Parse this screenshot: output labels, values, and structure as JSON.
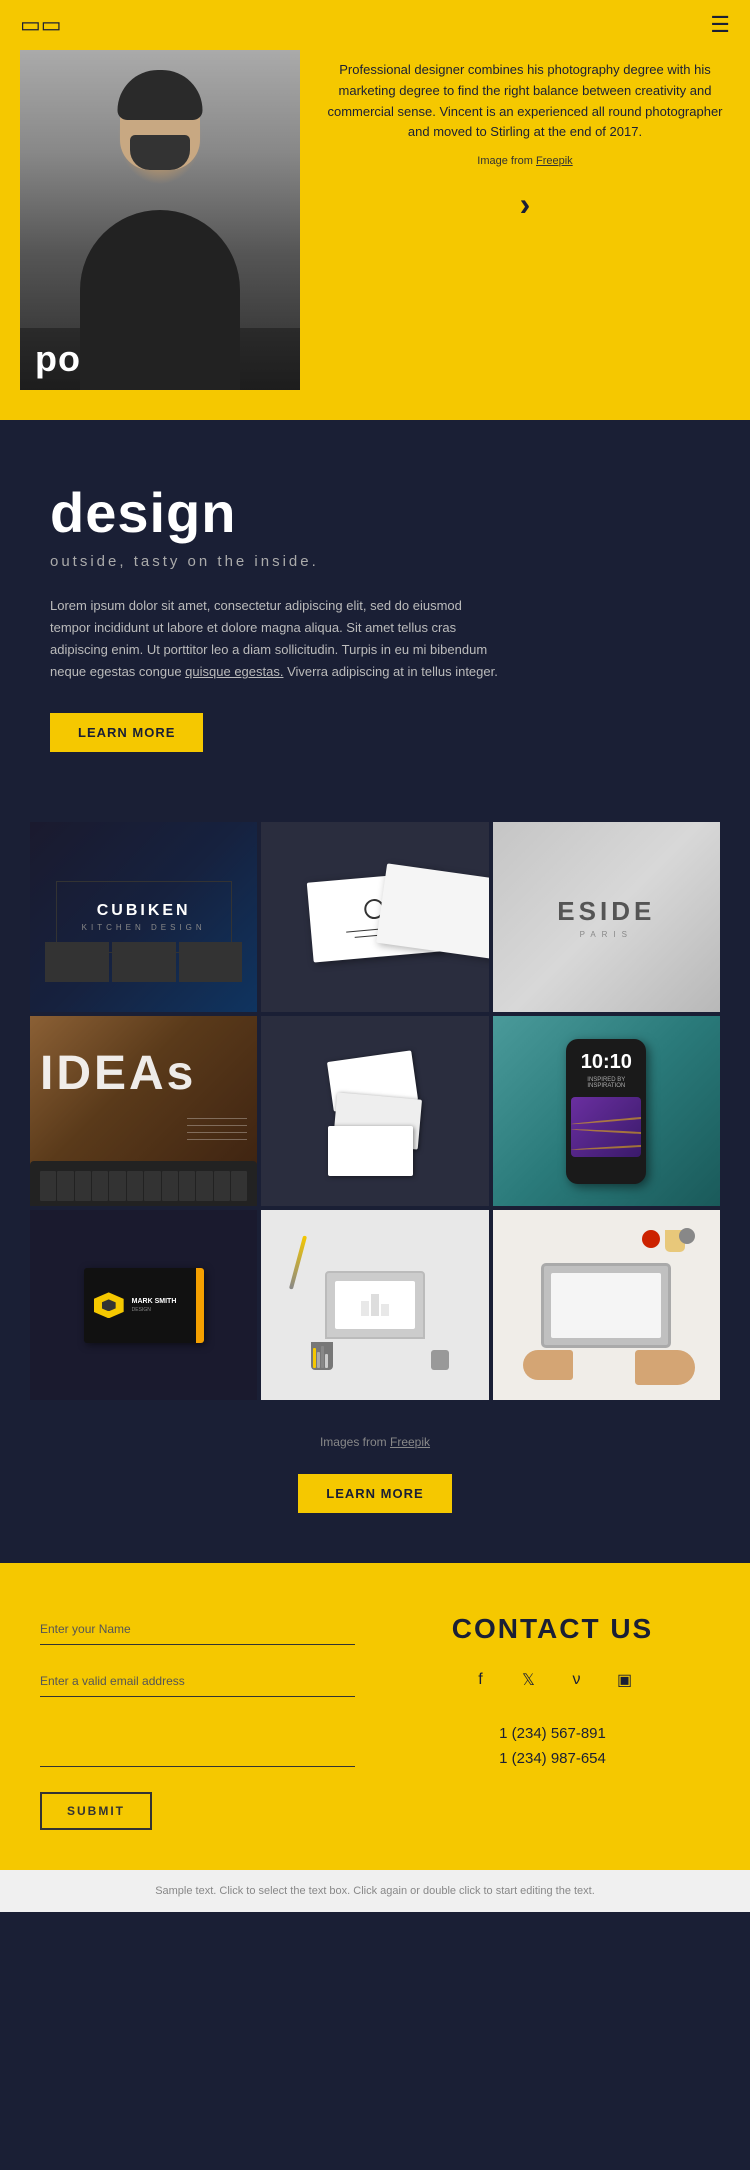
{
  "header": {
    "logo_icon": "book-open-icon",
    "menu_icon": "hamburger-icon"
  },
  "hero": {
    "title": "portfolio",
    "description": "Professional designer combines his photography degree with his marketing degree to find the right balance between creativity and commercial sense. Vincent is an experienced all round photographer and moved to Stirling at the end of 2017.",
    "image_credit_prefix": "Image from",
    "image_credit_link": "Freepik",
    "arrow_label": "›"
  },
  "design_section": {
    "heading": "design",
    "subtitle": "outside, tasty on the inside.",
    "body": "Lorem ipsum dolor sit amet, consectetur adipiscing elit, sed do eiusmod tempor incididunt ut labore et dolore magna aliqua. Sit amet tellus cras adipiscing enim. Ut porttitor leo a diam sollicitudin. Turpis in eu mi bibendum neque egestas congue quisque egestas. Viverra adipiscing at in tellus integer.",
    "learn_more_label": "LEARN MORE"
  },
  "portfolio_grid": {
    "items": [
      {
        "id": "cubiken",
        "brand": "CUBIKEN",
        "sub": "KITCHEN DESIGN"
      },
      {
        "id": "business-cards-1",
        "label": "Business Cards"
      },
      {
        "id": "eside",
        "brand": "ESIDE",
        "sub": "PARIS"
      },
      {
        "id": "ideas",
        "label": "IDEAs"
      },
      {
        "id": "business-cards-2",
        "label": "Business Cards Stack"
      },
      {
        "id": "phone",
        "time": "10:10",
        "sub": "INSPIRED BY INSPIRATION"
      },
      {
        "id": "design-card",
        "label": "Design Business Card"
      },
      {
        "id": "stationery",
        "label": "Stationery"
      },
      {
        "id": "workspace",
        "label": "Workspace"
      }
    ],
    "credit_prefix": "Images from",
    "credit_link": "Freepik",
    "learn_more_label": "LEARN MORE"
  },
  "contact_section": {
    "title": "CONTACT US",
    "form": {
      "name_placeholder": "Enter your Name",
      "email_placeholder": "Enter a valid email address",
      "message_placeholder": "",
      "submit_label": "SUBMIT"
    },
    "social_icons": [
      "facebook-icon",
      "twitter-icon",
      "vimeo-icon",
      "instagram-icon"
    ],
    "social_symbols": [
      "f",
      "🐦",
      "v",
      "📷"
    ],
    "phones": [
      "1 (234) 567-891",
      "1 (234) 987-654"
    ]
  },
  "footer": {
    "note": "Sample text. Click to select the text box. Click again or double click to start editing the text."
  }
}
